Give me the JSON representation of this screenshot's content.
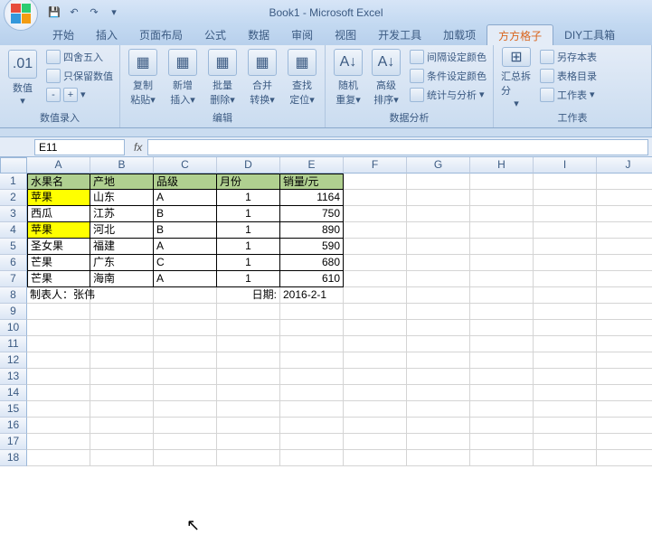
{
  "app_title": "Book1 - Microsoft Excel",
  "tabs": [
    "开始",
    "插入",
    "页面布局",
    "公式",
    "数据",
    "审阅",
    "视图",
    "开发工具",
    "加载项",
    "方方格子",
    "DIY工具箱"
  ],
  "active_tab": 9,
  "ribbon": {
    "g1": {
      "label": "数值录入",
      "big": "数值",
      "items": [
        "四舍五入",
        "只保留数值"
      ],
      "plus_minus": [
        "-",
        "+"
      ]
    },
    "g2": {
      "label": "编辑",
      "items": [
        "复制粘贴",
        "新增插入",
        "批量删除",
        "合并转换",
        "查找定位"
      ]
    },
    "g3": {
      "label": "数据分析",
      "items": [
        "随机重复",
        "高级排序"
      ],
      "side": [
        "间隔设定颜色",
        "条件设定颜色",
        "统计与分析"
      ]
    },
    "g4": {
      "label": "工作表",
      "big": "汇总拆分",
      "side": [
        "另存本表",
        "表格目录",
        "工作表"
      ]
    }
  },
  "name_box": "E11",
  "fx_label": "fx",
  "cols": [
    "A",
    "B",
    "C",
    "D",
    "E",
    "F",
    "G",
    "H",
    "I",
    "J"
  ],
  "rows_count": 18,
  "header": [
    "水果名",
    "产地",
    "品级",
    "月份",
    "销量/元"
  ],
  "data_rows": [
    {
      "a": "苹果",
      "b": "山东",
      "c": "A",
      "d": "1",
      "e": "1164",
      "ay": true
    },
    {
      "a": "西瓜",
      "b": "江苏",
      "c": "B",
      "d": "1",
      "e": "750",
      "ay": false
    },
    {
      "a": "苹果",
      "b": "河北",
      "c": "B",
      "d": "1",
      "e": "890",
      "ay": true
    },
    {
      "a": "圣女果",
      "b": "福建",
      "c": "A",
      "d": "1",
      "e": "590",
      "ay": false
    },
    {
      "a": "芒果",
      "b": "广东",
      "c": "C",
      "d": "1",
      "e": "680",
      "ay": false
    },
    {
      "a": "芒果",
      "b": "海南",
      "c": "A",
      "d": "1",
      "e": "610",
      "ay": false
    }
  ],
  "footer": {
    "author_label": "制表人：张伟",
    "date_label": "日期:",
    "date": "2016-2-1"
  }
}
